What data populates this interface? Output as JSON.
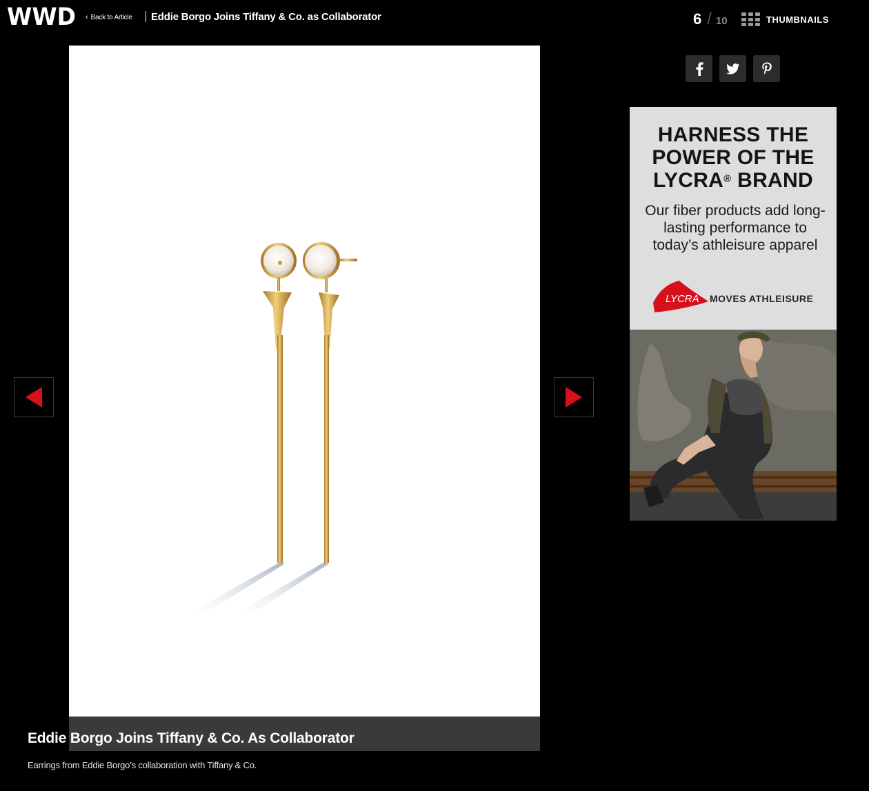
{
  "header": {
    "logo_text": "WWD",
    "back_label": "Back to Article",
    "gallery_title": "Eddie Borgo Joins Tiffany & Co. as Collaborator",
    "counter": {
      "current": "6",
      "separator": "/",
      "total": "10"
    },
    "thumbnails_label": "THUMBNAILS"
  },
  "gallery": {
    "image_subject": "earrings",
    "prev_label": "previous-slide",
    "next_label": "next-slide",
    "caption_title": "Eddie Borgo Joins Tiffany & Co. As Collaborator",
    "caption_text": "Earrings from Eddie Borgo’s collaboration with Tiffany & Co."
  },
  "social": [
    {
      "name": "facebook-icon"
    },
    {
      "name": "twitter-icon"
    },
    {
      "name": "pinterest-icon"
    }
  ],
  "ad": {
    "headline_line1": "HARNESS THE",
    "headline_line2": "POWER OF THE",
    "headline_line3_pre": "LYCRA",
    "headline_line3_mark": "®",
    "headline_line3_post": " BRAND",
    "body": "Our fiber products add long-lasting performance to today’s athleisure apparel",
    "logo_brand": "LYCRA",
    "logo_tagline": "MOVES ATHLEISURE"
  },
  "colors": {
    "accent_red": "#d7101e",
    "background": "#000000",
    "caption_bar": "#3a3a3a"
  }
}
